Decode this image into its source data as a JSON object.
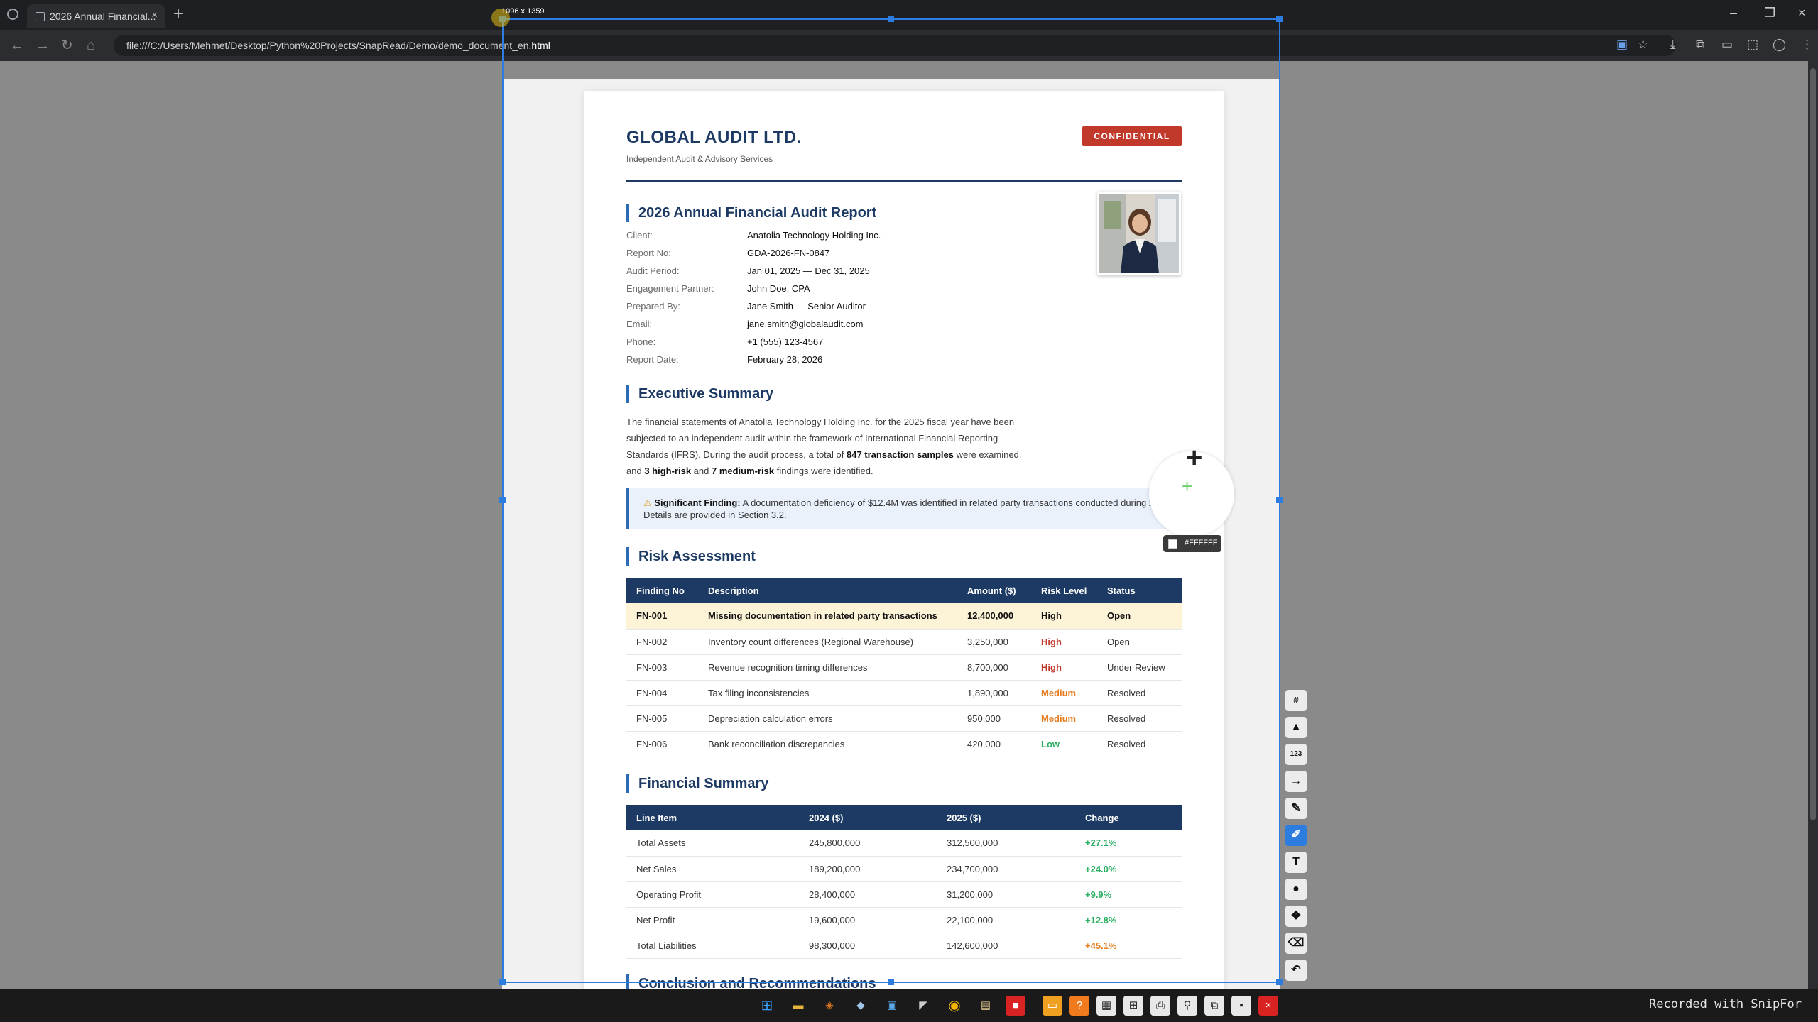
{
  "browser": {
    "tab_title": "2026 Annual Financial...",
    "tab_close": "×",
    "new_tab": "+",
    "url_prefix": "file:///C:/Users/Mehmet/Desktop/Python%20Projects/SnapRead/Demo/demo_document_en",
    "url_suffix": ".html",
    "nav": {
      "back": "←",
      "forward": "→",
      "reload": "↻",
      "home": "⌂"
    },
    "window": {
      "minimize": "–",
      "restore": "❐",
      "close": "×"
    }
  },
  "capture": {
    "dimensions_label": "1096 x 1359",
    "color_hex": "#FFFFFF"
  },
  "document": {
    "company": "GLOBAL AUDIT LTD.",
    "tagline": "Independent Audit & Advisory Services",
    "badge": "CONFIDENTIAL",
    "report_title": "2026 Annual Financial Audit Report",
    "meta": [
      {
        "label": "Client:",
        "value": "Anatolia Technology Holding Inc."
      },
      {
        "label": "Report No:",
        "value": "GDA-2026-FN-0847"
      },
      {
        "label": "Audit Period:",
        "value": "Jan 01, 2025 — Dec 31, 2025"
      },
      {
        "label": "Engagement Partner:",
        "value": "John Doe, CPA"
      },
      {
        "label": "Prepared By:",
        "value": "Jane Smith — Senior Auditor"
      },
      {
        "label": "Email:",
        "value": "jane.smith@globalaudit.com"
      },
      {
        "label": "Phone:",
        "value": "+1 (555) 123-4567"
      },
      {
        "label": "Report Date:",
        "value": "February 28, 2026"
      }
    ],
    "exec_summary": {
      "title": "Executive Summary",
      "text_1": "The financial statements of Anatolia Technology Holding Inc. for the 2025 fiscal year have been subjected to an independent audit within the framework of International Financial Reporting Standards (IFRS). During the audit process, a total of ",
      "bold_1": "847 transaction samples",
      "text_2": " were examined, and ",
      "bold_2": "3 high-risk",
      "text_3": " and ",
      "bold_3": "7 medium-risk",
      "text_4": " findings were identified."
    },
    "callout": {
      "icon": "⚠",
      "label": "Significant Finding:",
      "text": " A documentation deficiency of $12.4M was identified in related party transactions conducted during 2025. Details are provided in Section 3.2."
    },
    "risk": {
      "title": "Risk Assessment",
      "headers": [
        "Finding No",
        "Description",
        "Amount ($)",
        "Risk Level",
        "Status"
      ],
      "rows": [
        {
          "id": "FN-001",
          "desc": "Missing documentation in related party transactions",
          "amount": "12,400,000",
          "level": "High",
          "status": "Open"
        },
        {
          "id": "FN-002",
          "desc": "Inventory count differences (Regional Warehouse)",
          "amount": "3,250,000",
          "level": "High",
          "status": "Open"
        },
        {
          "id": "FN-003",
          "desc": "Revenue recognition timing differences",
          "amount": "8,700,000",
          "level": "High",
          "status": "Under Review"
        },
        {
          "id": "FN-004",
          "desc": "Tax filing inconsistencies",
          "amount": "1,890,000",
          "level": "Medium",
          "status": "Resolved"
        },
        {
          "id": "FN-005",
          "desc": "Depreciation calculation errors",
          "amount": "950,000",
          "level": "Medium",
          "status": "Resolved"
        },
        {
          "id": "FN-006",
          "desc": "Bank reconciliation discrepancies",
          "amount": "420,000",
          "level": "Low",
          "status": "Resolved"
        }
      ]
    },
    "financial": {
      "title": "Financial Summary",
      "headers": [
        "Line Item",
        "2024 ($)",
        "2025 ($)",
        "Change"
      ],
      "rows": [
        {
          "item": "Total Assets",
          "y2024": "245,800,000",
          "y2025": "312,500,000",
          "change": "+27.1%"
        },
        {
          "item": "Net Sales",
          "y2024": "189,200,000",
          "y2025": "234,700,000",
          "change": "+24.0%"
        },
        {
          "item": "Operating Profit",
          "y2024": "28,400,000",
          "y2025": "31,200,000",
          "change": "+9.9%"
        },
        {
          "item": "Net Profit",
          "y2024": "19,600,000",
          "y2025": "22,100,000",
          "change": "+12.8%"
        },
        {
          "item": "Total Liabilities",
          "y2024": "98,300,000",
          "y2025": "142,600,000",
          "change": "+45.1%"
        }
      ]
    },
    "next_section": "Conclusion and Recommendations"
  },
  "tools": [
    {
      "name": "grid-tool",
      "glyph": "#"
    },
    {
      "name": "stamp-tool",
      "glyph": "▲"
    },
    {
      "name": "counter-tool",
      "glyph": "123"
    },
    {
      "name": "arrow-tool",
      "glyph": "→"
    },
    {
      "name": "pen-tool",
      "glyph": "✎"
    },
    {
      "name": "marker-tool",
      "glyph": "✐"
    },
    {
      "name": "text-tool",
      "glyph": "T"
    },
    {
      "name": "color-tool",
      "glyph": "●"
    },
    {
      "name": "move-tool",
      "glyph": "✥"
    },
    {
      "name": "eraser-tool",
      "glyph": "⌫"
    },
    {
      "name": "undo-tool",
      "glyph": "↶"
    }
  ],
  "colors": {
    "accent": "#2d7de0",
    "brand": "#1c3a63",
    "danger": "#c0392b",
    "warning": "#e67e22",
    "success": "#27ae60"
  },
  "watermark": "Recorded with SnipFor"
}
